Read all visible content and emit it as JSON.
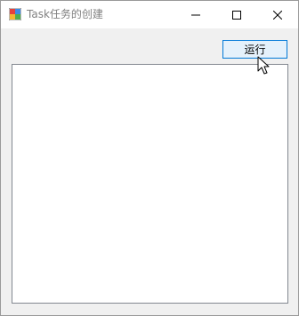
{
  "window": {
    "title": "Task任务的创建",
    "title_color": "#808080",
    "controls": {
      "minimize_icon": "minimize-icon",
      "maximize_icon": "maximize-icon",
      "close_icon": "close-icon"
    }
  },
  "toolbar": {
    "run_label": "运行"
  },
  "main": {
    "list_items": []
  },
  "colors": {
    "window_bg": "#f0f0f0",
    "button_border": "#0078d7",
    "button_bg": "#e5f1fb",
    "list_border": "#828790"
  }
}
